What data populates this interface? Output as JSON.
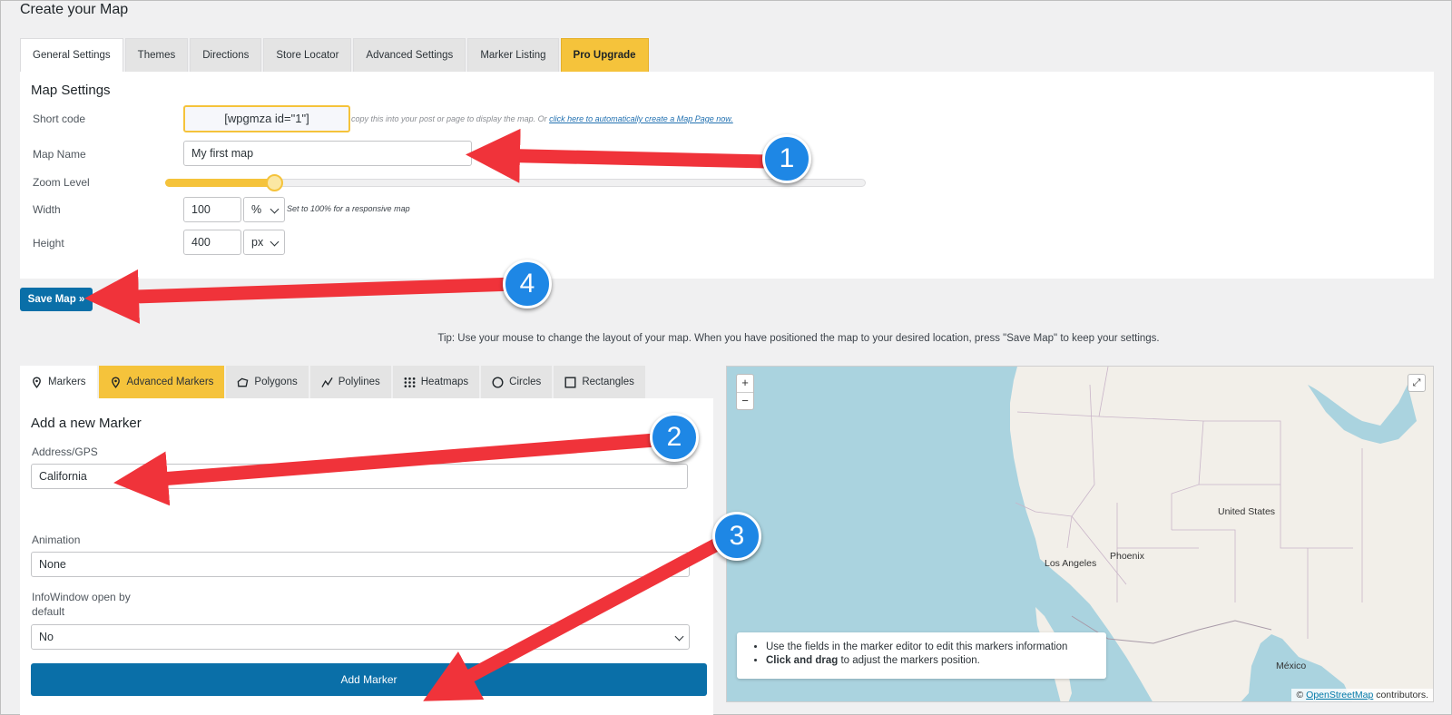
{
  "page_title": "Create your Map",
  "tabs": [
    "General Settings",
    "Themes",
    "Directions",
    "Store Locator",
    "Advanced Settings",
    "Marker Listing",
    "Pro Upgrade"
  ],
  "map_settings": {
    "title": "Map Settings",
    "shortcode_label": "Short code",
    "shortcode_value": "[wpgmza id=\"1\"]",
    "shortcode_hint": "copy this into your post or page to display the map. Or",
    "shortcode_link": "click here to automatically create a Map Page now.",
    "map_name_label": "Map Name",
    "map_name_value": "My first map",
    "zoom_label": "Zoom Level",
    "zoom_fraction": 0.155,
    "width_label": "Width",
    "width_value": "100",
    "width_unit": "%",
    "width_hint": "Set to 100% for a responsive map",
    "height_label": "Height",
    "height_value": "400",
    "height_unit": "px"
  },
  "save_button": "Save Map »",
  "tip": "Tip: Use your mouse to change the layout of your map. When you have positioned the map to your desired location, press \"Save Map\" to keep your settings.",
  "marker_tabs": [
    "Markers",
    "Advanced Markers",
    "Polygons",
    "Polylines",
    "Heatmaps",
    "Circles",
    "Rectangles"
  ],
  "marker_form": {
    "title": "Add a new Marker",
    "address_label": "Address/GPS",
    "address_value": "California",
    "animation_label": "Animation",
    "animation_value": "None",
    "infowindow_label_1": "InfoWindow open by",
    "infowindow_label_2": "default",
    "infowindow_value": "No",
    "add_button": "Add Marker"
  },
  "map": {
    "zoom_in": "+",
    "zoom_out": "−",
    "labels": [
      "United States",
      "Phoenix",
      "Los Angeles",
      "México"
    ],
    "info_1": "Use the fields in the marker editor to edit this markers information",
    "info_2_bold": "Click and drag",
    "info_2_rest": " to adjust the markers position.",
    "attribution_prefix": "©",
    "attribution_link": "OpenStreetMap",
    "attribution_suffix": " contributors."
  },
  "annotations": [
    "1",
    "2",
    "3",
    "4"
  ],
  "colors": {
    "accent_yellow": "#f5c33b",
    "button_blue": "#0a6fa8",
    "arrow_red": "#f0333a",
    "badge_blue": "#1e87e5"
  }
}
